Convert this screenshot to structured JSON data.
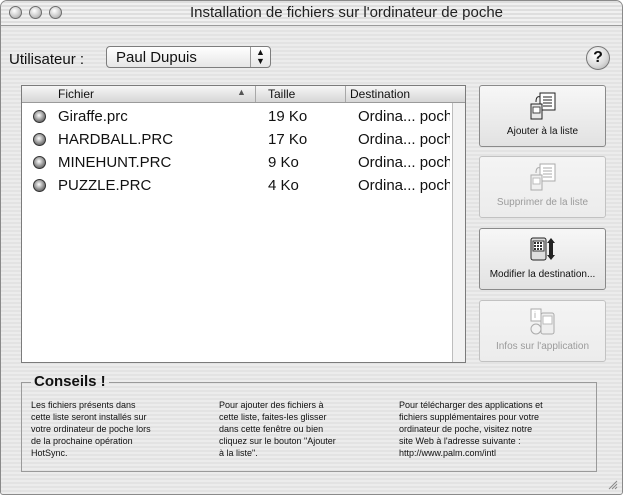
{
  "window": {
    "title": "Installation de fichiers sur l'ordinateur de poche"
  },
  "user": {
    "label": "Utilisateur :",
    "selected": "Paul Dupuis"
  },
  "help": {
    "label": "?"
  },
  "file_list": {
    "columns": {
      "file": "Fichier",
      "size": "Taille",
      "destination": "Destination"
    },
    "rows": [
      {
        "name": "Giraffe.prc",
        "size": "19 Ko",
        "destination": "Ordina... poch"
      },
      {
        "name": "HARDBALL.PRC",
        "size": "17 Ko",
        "destination": "Ordina... poch"
      },
      {
        "name": "MINEHUNT.PRC",
        "size": "9 Ko",
        "destination": "Ordina... poch"
      },
      {
        "name": "PUZZLE.PRC",
        "size": "4 Ko",
        "destination": "Ordina... poch"
      }
    ]
  },
  "buttons": {
    "add": "Ajouter à la liste",
    "remove": "Supprimer de la liste",
    "change_dest": "Modifier la destination...",
    "app_info": "Infos sur l'application"
  },
  "tips": {
    "title": "Conseils !",
    "col1": [
      "Les fichiers présents dans",
      "cette liste seront installés sur",
      "votre ordinateur de poche lors",
      "de la prochaine opération",
      "HotSync."
    ],
    "col2": [
      "Pour ajouter des fichiers à",
      "cette liste, faites-les glisser",
      "dans cette fenêtre ou bien",
      "cliquez sur le bouton \"Ajouter",
      "à la liste\"."
    ],
    "col3": [
      "Pour télécharger des applications et",
      "fichiers supplémentaires pour votre",
      "ordinateur de poche, visitez notre",
      "site Web à l'adresse suivante :",
      "http://www.palm.com/intl"
    ]
  },
  "icons": [
    "close-button",
    "minimize-button",
    "zoom-button",
    "updown-arrows-icon",
    "help-icon",
    "sort-up-icon",
    "prc-file-icon",
    "add-file-icon",
    "remove-file-icon",
    "change-destination-icon",
    "app-info-icon",
    "resize-grip-icon"
  ]
}
